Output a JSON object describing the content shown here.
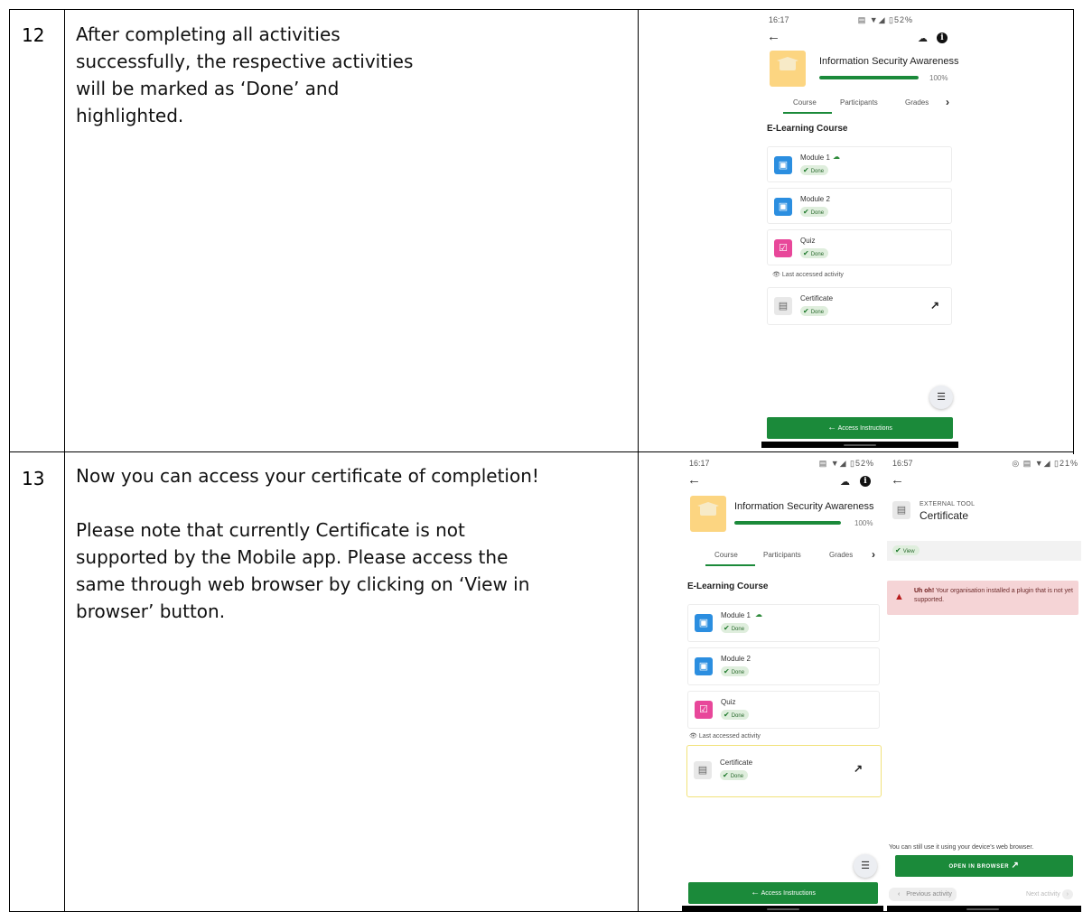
{
  "rows": [
    {
      "number": "12",
      "text_lines": [
        "After completing all activities",
        "successfully, the respective activities",
        "will be marked as ‘Done’ and",
        "highlighted."
      ]
    },
    {
      "number": "13",
      "text_lines": [
        "Now you can access your certificate of completion!",
        "",
        "Please note that currently Certificate is not",
        "supported by the Mobile app. Please access the",
        "same through web browser by clicking on ‘View in",
        "browser’ button."
      ]
    }
  ],
  "course_screen": {
    "status_time": "16:17",
    "status_icons": "▤ ▼◢ ▯52%",
    "course_title": "Information Security Awareness",
    "progress_percent": 100,
    "progress_label": "100%",
    "tabs": [
      "Course",
      "Participants",
      "Grades"
    ],
    "section_title": "E-Learning Course",
    "activities": [
      {
        "name": "Module 1",
        "status": "Done"
      },
      {
        "name": "Module 2",
        "status": "Done"
      },
      {
        "name": "Quiz",
        "status": "Done"
      },
      {
        "name": "Certificate",
        "status": "Done"
      }
    ],
    "last_accessed": "Last accessed activity",
    "access_instructions": "Access Instructions"
  },
  "external_tool_screen": {
    "status_time": "16:57",
    "status_icons": "◎ ▤ ▼◢ ▯21%",
    "label": "EXTERNAL TOOL",
    "title": "Certificate",
    "view_badge": "View",
    "error_bold": "Uh oh!",
    "error_text": " Your organisation installed a plugin that is not yet supported.",
    "web_note": "You can still use it using your device's web browser.",
    "open_browser": "OPEN IN BROWSER",
    "previous_activity": "Previous activity",
    "next_activity": "Next activity"
  }
}
